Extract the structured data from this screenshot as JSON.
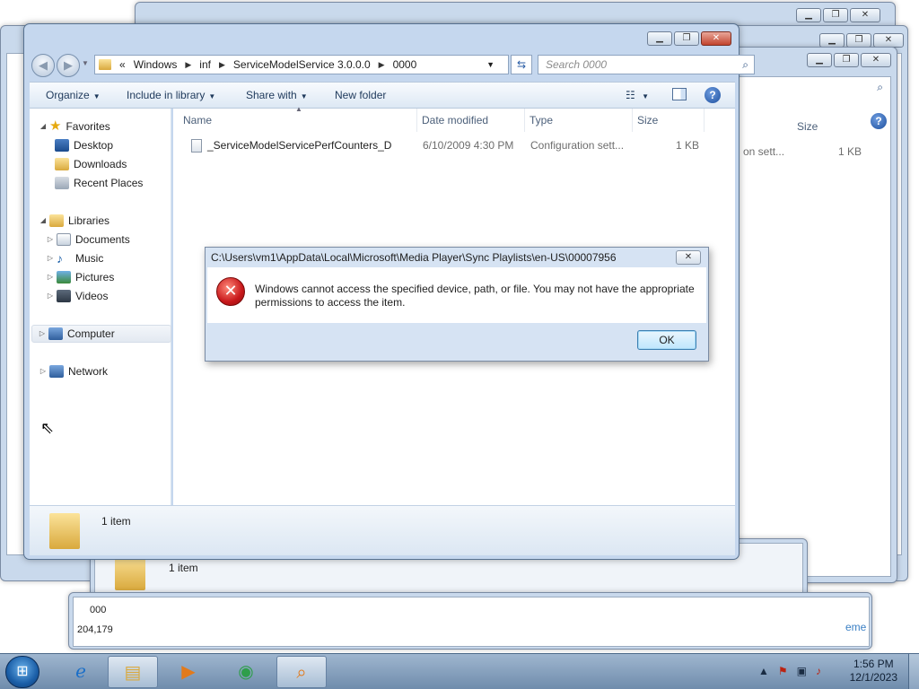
{
  "background_windows": {
    "size_header": "Size",
    "type_fragment": "on sett...",
    "size_value": "1 KB",
    "status_count": "1 item",
    "status_text_fragment": "204,179",
    "name_fragment": "000",
    "tail_text": "eme"
  },
  "explorer": {
    "address": {
      "overflow_marker": "«",
      "crumbs": [
        "Windows",
        "inf",
        "ServiceModelService 3.0.0.0",
        "0000"
      ]
    },
    "search_placeholder": "Search 0000",
    "toolbar": {
      "organize": "Organize",
      "include_in_library": "Include in library",
      "share_with": "Share with",
      "new_folder": "New folder",
      "help": "?"
    },
    "nav": {
      "favorites": "Favorites",
      "desktop": "Desktop",
      "downloads": "Downloads",
      "recent_places": "Recent Places",
      "libraries": "Libraries",
      "documents": "Documents",
      "music": "Music",
      "pictures": "Pictures",
      "videos": "Videos",
      "computer": "Computer",
      "network": "Network"
    },
    "columns": {
      "name": "Name",
      "date_modified": "Date modified",
      "type": "Type",
      "size": "Size"
    },
    "files": [
      {
        "name": "_ServiceModelServicePerfCounters_D",
        "date_modified": "6/10/2009 4:30 PM",
        "type": "Configuration sett...",
        "size": "1 KB"
      }
    ],
    "status": {
      "item_count": "1 item"
    }
  },
  "dialog": {
    "title": "C:\\Users\\vm1\\AppData\\Local\\Microsoft\\Media Player\\Sync Playlists\\en-US\\00007956",
    "message": "Windows cannot access the specified device, path, or file.  You may not have the appropriate permissions to access the item.",
    "ok_label": "OK",
    "icon": "error-icon"
  },
  "taskbar": {
    "time": "1:56 PM",
    "date": "12/1/2023",
    "pinned": [
      "internet-explorer-icon",
      "file-explorer-icon",
      "media-player-icon",
      "chrome-icon",
      "search-app-icon"
    ]
  },
  "colors": {
    "window_frame": "#c5d7ee",
    "error_red": "#c8181b",
    "ok_button": "#bee6fd",
    "taskbar": "#6f8cac"
  }
}
